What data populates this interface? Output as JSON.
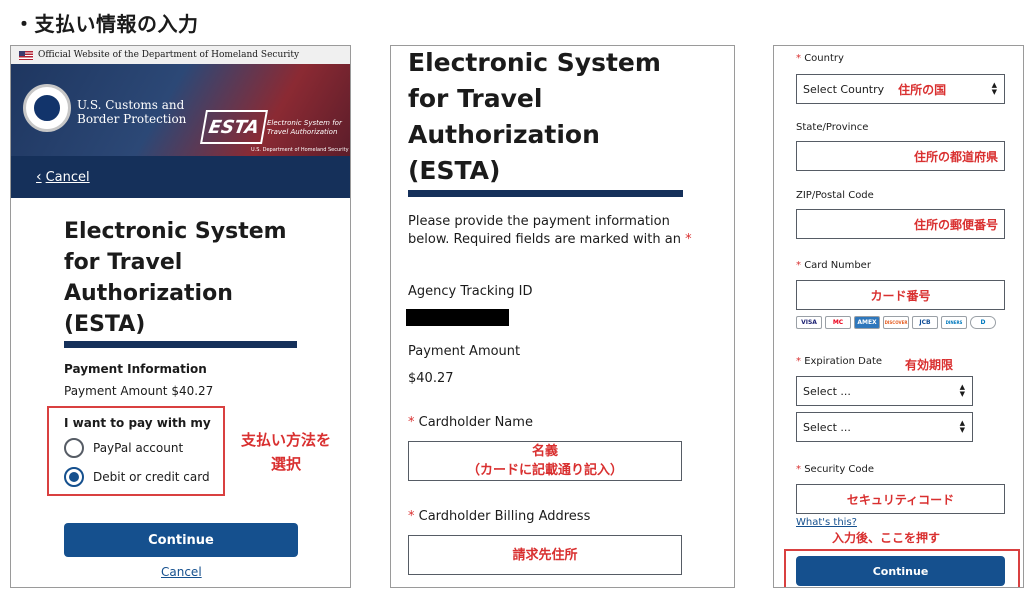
{
  "page_heading": "・支払い情報の入力",
  "panel1": {
    "gov_banner": "Official Website of the Department of Homeland Security",
    "agency_name_line1": "U.S. Customs and",
    "agency_name_line2": "Border Protection",
    "esta_logo": "ESTA",
    "esta_tagline_line1": "Electronic System for",
    "esta_tagline_line2": "Travel Authorization",
    "esta_dept": "U.S. Department of Homeland Security",
    "cancel_link": "Cancel",
    "title": [
      "Electronic System",
      "for Travel",
      "Authorization",
      "(ESTA)"
    ],
    "payment_info_label": "Payment Information",
    "payment_amount": "Payment Amount $40.27",
    "pay_with_label": "I want to pay with my",
    "options": [
      {
        "label": "PayPal account",
        "checked": false
      },
      {
        "label": "Debit or credit card",
        "checked": true
      }
    ],
    "annotation": [
      "支払い方法を",
      "選択"
    ],
    "continue_label": "Continue",
    "cancel_bottom": "Cancel"
  },
  "panel2": {
    "title": [
      "Electronic System",
      "for Travel",
      "Authorization",
      "(ESTA)"
    ],
    "instructions": "Please provide the payment information below. Required fields are marked with an",
    "required_mark": "*",
    "tracking_label": "Agency Tracking ID",
    "amount_label": "Payment Amount",
    "amount_value": "$40.27",
    "cardholder_label": "Cardholder Name",
    "cardholder_note": [
      "名義",
      "（カードに記載通り記入）"
    ],
    "billing_label": "Cardholder Billing Address",
    "billing_note": "請求先住所"
  },
  "panel3": {
    "country_label": "Country",
    "country_value": "Select Country",
    "country_note": "住所の国",
    "state_label": "State/Province",
    "state_note": "住所の都道府県",
    "zip_label": "ZIP/Postal Code",
    "zip_note": "住所の郵便番号",
    "card_number_label": "Card Number",
    "card_number_note": "カード番号",
    "card_brands": [
      "VISA",
      "MC",
      "AMEX",
      "DISCOVER",
      "JCB",
      "DINERS",
      "D"
    ],
    "expiry_label": "Expiration Date",
    "expiry_note": "有効期限",
    "expiry_month": "Select ...",
    "expiry_year": "Select ...",
    "security_label": "Security Code",
    "security_note": "セキュリティコード",
    "whats_this": "What's this?",
    "push_note": "入力後、ここを押す",
    "continue_label": "Continue"
  },
  "colors": {
    "navy": "#15305a",
    "button_blue": "#15508e",
    "annotation_red": "#d93030"
  }
}
